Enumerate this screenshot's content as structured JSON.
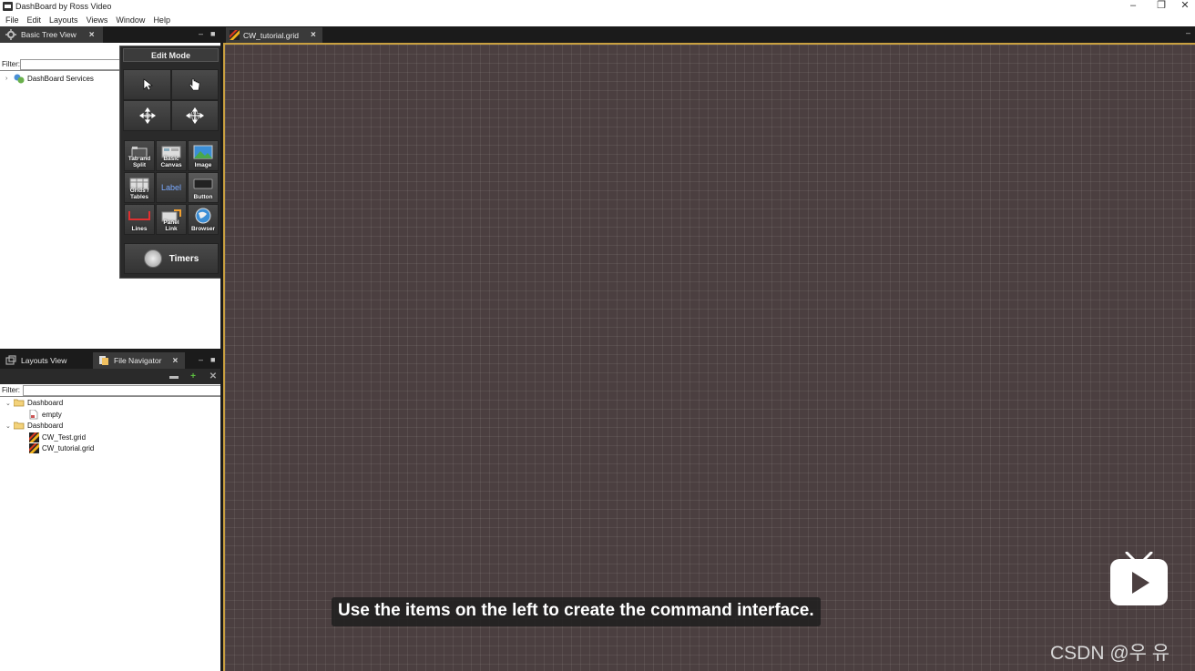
{
  "window": {
    "title": "DashBoard by Ross Video",
    "controls": [
      "–",
      "❐",
      "✕"
    ]
  },
  "menu": [
    "File",
    "Edit",
    "Layouts",
    "Views",
    "Window",
    "Help"
  ],
  "tree_pane": {
    "tab_label": "Basic Tree View",
    "filter_label": "Filter:",
    "filter_value": "",
    "items": [
      {
        "label": "DashBoard Services"
      }
    ]
  },
  "palette": {
    "title": "Edit Mode",
    "tools": [
      "select-arrow",
      "hand-pointer",
      "move-cross",
      "resize-cross"
    ],
    "components": [
      {
        "label": "Tab and Split",
        "icon": "tab-split-icon"
      },
      {
        "label": "Basic Canvas",
        "icon": "canvas-icon"
      },
      {
        "label": "Image",
        "icon": "image-icon"
      },
      {
        "label": "Grids / Tables",
        "icon": "grid-icon"
      },
      {
        "label": "Label",
        "icon": "label-icon"
      },
      {
        "label": "Button",
        "icon": "button-icon"
      },
      {
        "label": "Lines",
        "icon": "lines-icon"
      },
      {
        "label": "Panel Link",
        "icon": "panel-link-icon"
      },
      {
        "label": "Browser",
        "icon": "browser-icon"
      }
    ],
    "timers_label": "Timers"
  },
  "nav_pane": {
    "tabs": [
      {
        "label": "Layouts View",
        "active": false
      },
      {
        "label": "File Navigator",
        "active": true
      }
    ],
    "filter_label": "Filter:",
    "tree": [
      {
        "label": "Dashboard",
        "type": "folder",
        "level": 0
      },
      {
        "label": "empty",
        "type": "file",
        "level": 1
      },
      {
        "label": "Dashboard",
        "type": "folder",
        "level": 0
      },
      {
        "label": "CW_Test.grid",
        "type": "grid",
        "level": 1
      },
      {
        "label": "CW_tutorial.grid",
        "type": "grid",
        "level": 1
      }
    ]
  },
  "document": {
    "tab_label": "CW_tutorial.grid",
    "canvas_color": "#4b3f40",
    "accent_color": "#c9a040"
  },
  "overlay": {
    "subtitle": "Use the items on the left to create the command interface.",
    "watermark": "CSDN @우 유"
  }
}
